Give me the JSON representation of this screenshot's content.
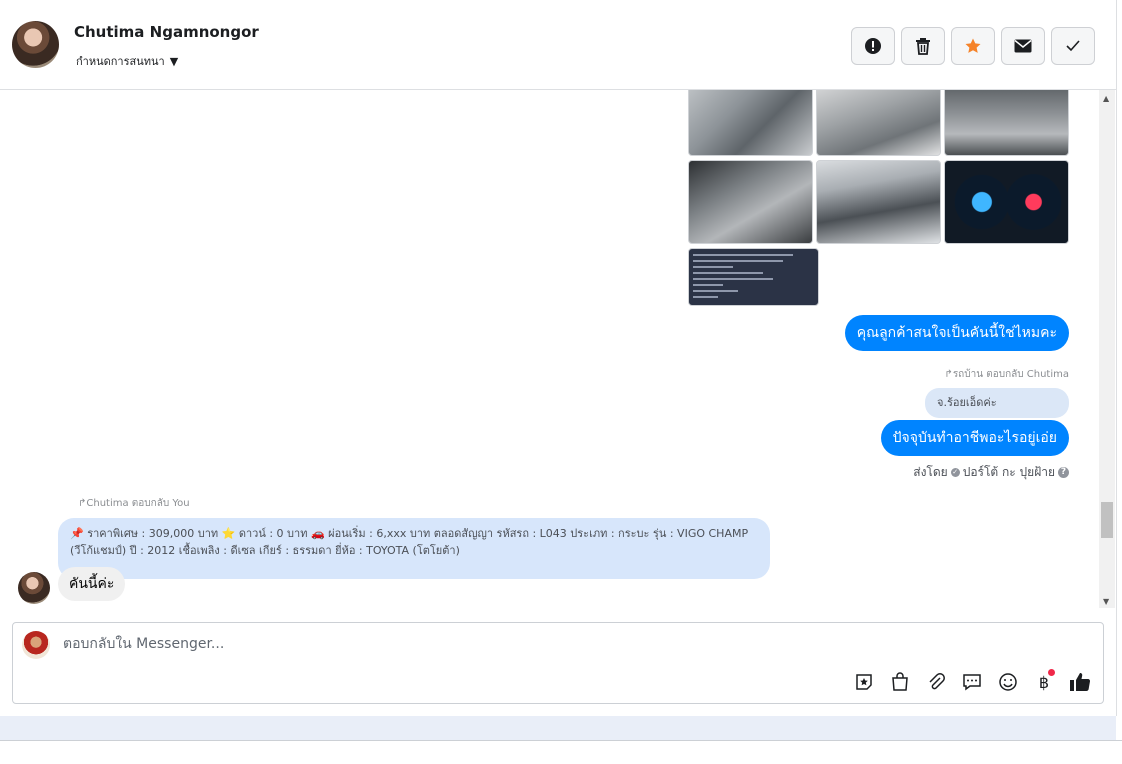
{
  "header": {
    "name": "Chutima Ngamnongor",
    "subtitle": "กำหนดการสนทนา",
    "actions": [
      {
        "icon": "alert-icon",
        "label": "report"
      },
      {
        "icon": "trash-icon",
        "label": "delete"
      },
      {
        "icon": "star-icon",
        "label": "star"
      },
      {
        "icon": "mail-icon",
        "label": "mark unread"
      },
      {
        "icon": "check-icon",
        "label": "done"
      }
    ],
    "star_color": "#f5832a"
  },
  "messages": {
    "out_1": "คุณลูกค้าสนใจเป็นคันนี้ใช่ไหมคะ",
    "reply_hint_1": "รถบ้าน ตอบกลับ Chutima",
    "quoted_1": "จ.ร้อยเอ็ดค่ะ",
    "out_2": "ปัจจุบันทำอาชีพอะไรอยู่เอ่ย",
    "sent_by_prefix": "ส่งโดย",
    "sent_by_name": "ปอร์โต้ กะ ปุยฝ้าย",
    "reply_hint_2": "Chutima ตอบกลับ You",
    "quoted_long_line1": "📌 ราคาพิเศษ : 309,000 บาท ⭐ ดาวน์ : 0 บาท 🚗 ผ่อนเริ่ม : 6,xxx บาท ตลอดสัญญา รหัสรถ : L043 ประเภท : กระบะ รุ่น : VIGO CHAMP",
    "quoted_long_line2": "(วีโก้แชมป์) ปี : 2012 เชื้อเพลิง : ดีเซล เกียร์ : ธรรมดา ยี่ห้อ : TOYOTA (โตโยต้า)",
    "in_1": "คันนี้ค่ะ"
  },
  "composer": {
    "placeholder": "ตอบกลับใน Messenger...",
    "tools": [
      "sticker-icon",
      "shop-bag-icon",
      "attachment-icon",
      "saved-reply-icon",
      "emoji-icon",
      "baht-icon",
      "like-icon"
    ]
  },
  "colors": {
    "accent": "#0084ff",
    "like": "#1c1e21"
  }
}
